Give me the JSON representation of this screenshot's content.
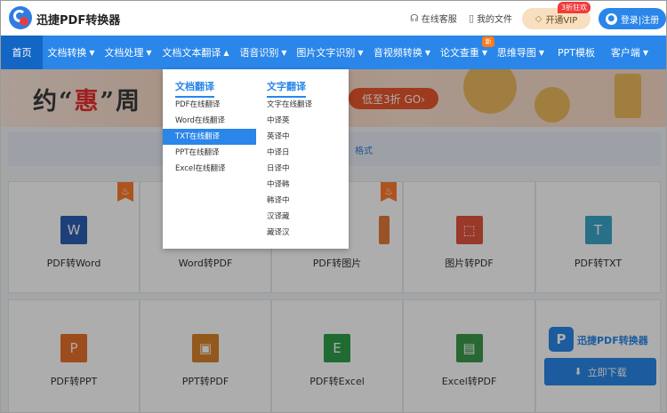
{
  "header": {
    "app_title": "迅捷PDF转换器",
    "service_label": "在线客服",
    "files_label": "我的文件",
    "vip_label": "开通VIP",
    "vip_badge": "3折狂欢",
    "login_label": "登录|注册"
  },
  "nav": {
    "items": [
      {
        "label": "首页",
        "active": true,
        "caret": ""
      },
      {
        "label": "文档转换",
        "caret": "▼"
      },
      {
        "label": "文档处理",
        "caret": "▼"
      },
      {
        "label": "文档文本翻译",
        "caret": "▲"
      },
      {
        "label": "语音识别",
        "caret": "▼"
      },
      {
        "label": "图片文字识别",
        "caret": "▼"
      },
      {
        "label": "音视频转换",
        "caret": "▼"
      },
      {
        "label": "论文查重",
        "caret": "▼"
      },
      {
        "label": "思维导图",
        "caret": "▼"
      },
      {
        "label": "PPT模板",
        "caret": ""
      },
      {
        "label": "客户端",
        "caret": "▼"
      }
    ],
    "new_badge": "新"
  },
  "banner": {
    "text_part1": "约“",
    "text_highlight": "惠",
    "text_part2": "”周",
    "cta": "低至3折 GO›"
  },
  "subbar": {
    "text": "格式"
  },
  "dropdown": {
    "doc_heading": "文档翻译",
    "doc_items": [
      "PDF在线翻译",
      "Word在线翻译",
      "TXT在线翻译",
      "PPT在线翻译",
      "Excel在线翻译"
    ],
    "doc_selected_index": 2,
    "text_heading": "文字翻译",
    "text_items": [
      "文字在线翻译",
      "中译英",
      "英译中",
      "中译日",
      "日译中",
      "中译韩",
      "韩译中",
      "汉译藏",
      "藏译汉"
    ]
  },
  "cards_row1": [
    {
      "label": "PDF转Word",
      "icon": "W",
      "color": "#2b5fb4",
      "hot": true
    },
    {
      "label": "Word转PDF",
      "icon": "",
      "color": "#d9a07a",
      "hot": false
    },
    {
      "label": "PDF转图片",
      "icon": "",
      "color": "#e47a3a",
      "hot": true
    },
    {
      "label": "图片转PDF",
      "icon": "⬚",
      "color": "#e0553e",
      "hot": false
    },
    {
      "label": "PDF转TXT",
      "icon": "T",
      "color": "#3aa6c9",
      "hot": false
    }
  ],
  "cards_row2": [
    {
      "label": "PDF转PPT",
      "icon": "P",
      "color": "#e8702d"
    },
    {
      "label": "PPT转PDF",
      "icon": "▣",
      "color": "#d9822b"
    },
    {
      "label": "PDF转Excel",
      "icon": "E",
      "color": "#2e9e4b"
    },
    {
      "label": "Excel转PDF",
      "icon": "▤",
      "color": "#3a9a4c"
    }
  ],
  "download": {
    "logo_char": "P",
    "name": "迅捷PDF转换器",
    "button": "立即下载"
  },
  "icons": [
    "headset-icon",
    "file-icon",
    "diamond-icon",
    "user-icon",
    "fire-icon",
    "download-icon"
  ]
}
